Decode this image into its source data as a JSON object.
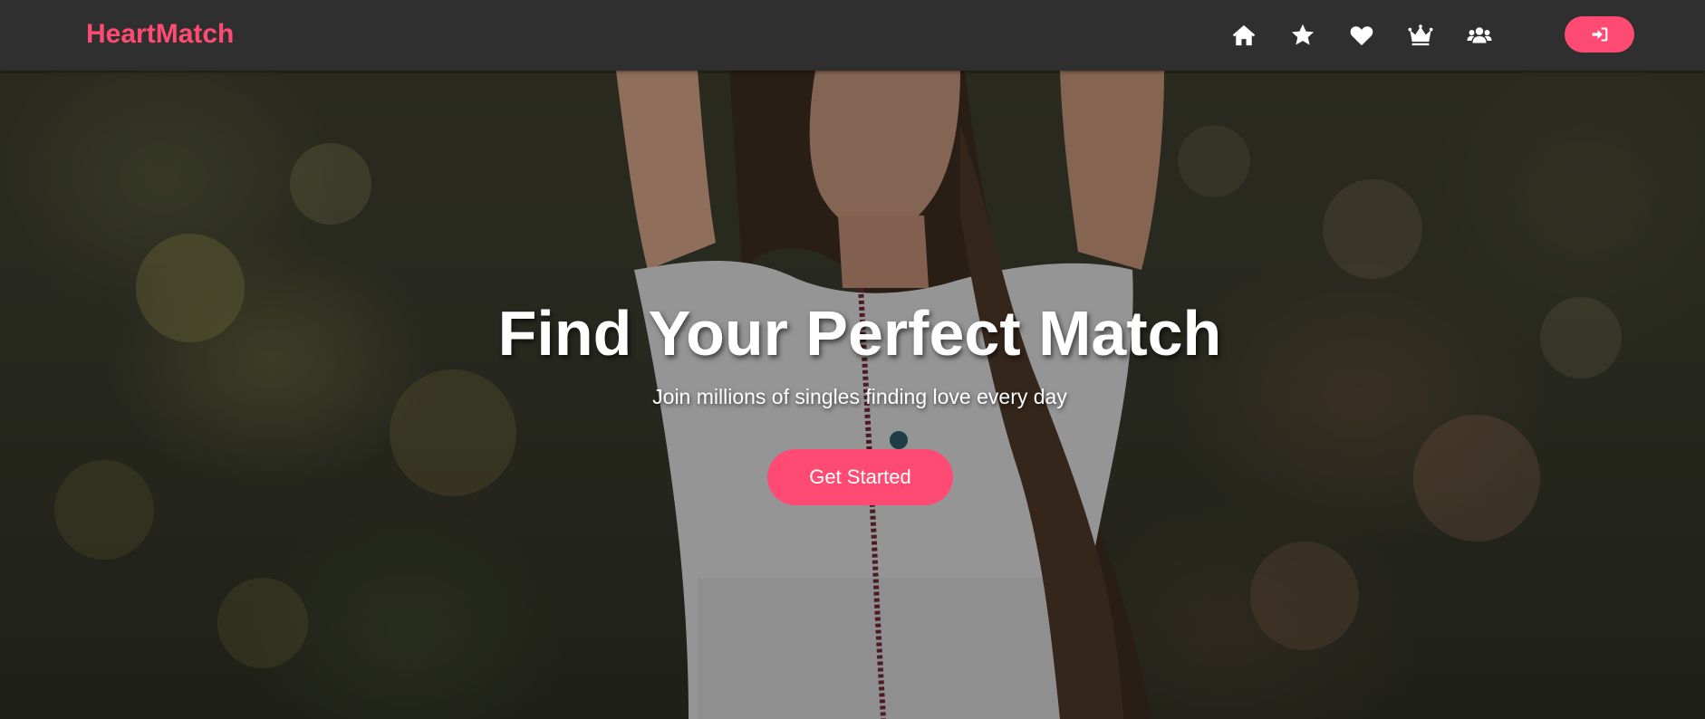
{
  "brand": {
    "name": "HeartMatch",
    "color": "#ff4b73"
  },
  "nav": {
    "icons": [
      "home-icon",
      "star-icon",
      "heart-icon",
      "crown-icon",
      "users-icon"
    ],
    "login_icon": "sign-in-icon",
    "background": "#2f2f2f"
  },
  "hero": {
    "title": "Find Your Perfect Match",
    "subtitle": "Join millions of singles finding love every day",
    "cta_label": "Get Started",
    "accent": "#ff4b73"
  }
}
